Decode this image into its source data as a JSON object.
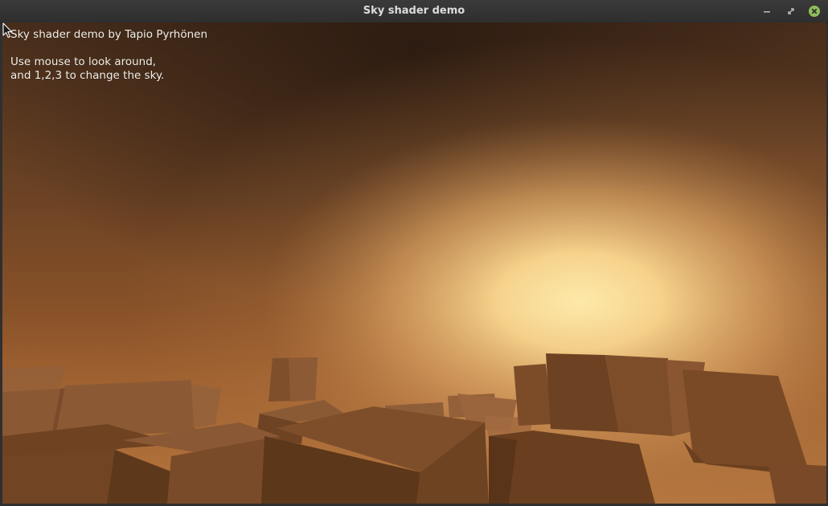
{
  "window": {
    "title": "Sky shader demo",
    "controls": [
      "minimize-icon",
      "maximize-icon",
      "close-icon"
    ],
    "close_color": "#8fbf5a"
  },
  "overlay": {
    "credit": "Sky shader demo by Tapio Pyrhönen",
    "instructions_line1": "Use mouse to look around,",
    "instructions_line2": "and 1,2,3 to change the sky."
  },
  "scene": {
    "sun_color": "#fce7a6",
    "sky_dark_color": "#2e1d12",
    "horizon_color": "#a35e2a",
    "block_color": "#7a4d2a"
  }
}
